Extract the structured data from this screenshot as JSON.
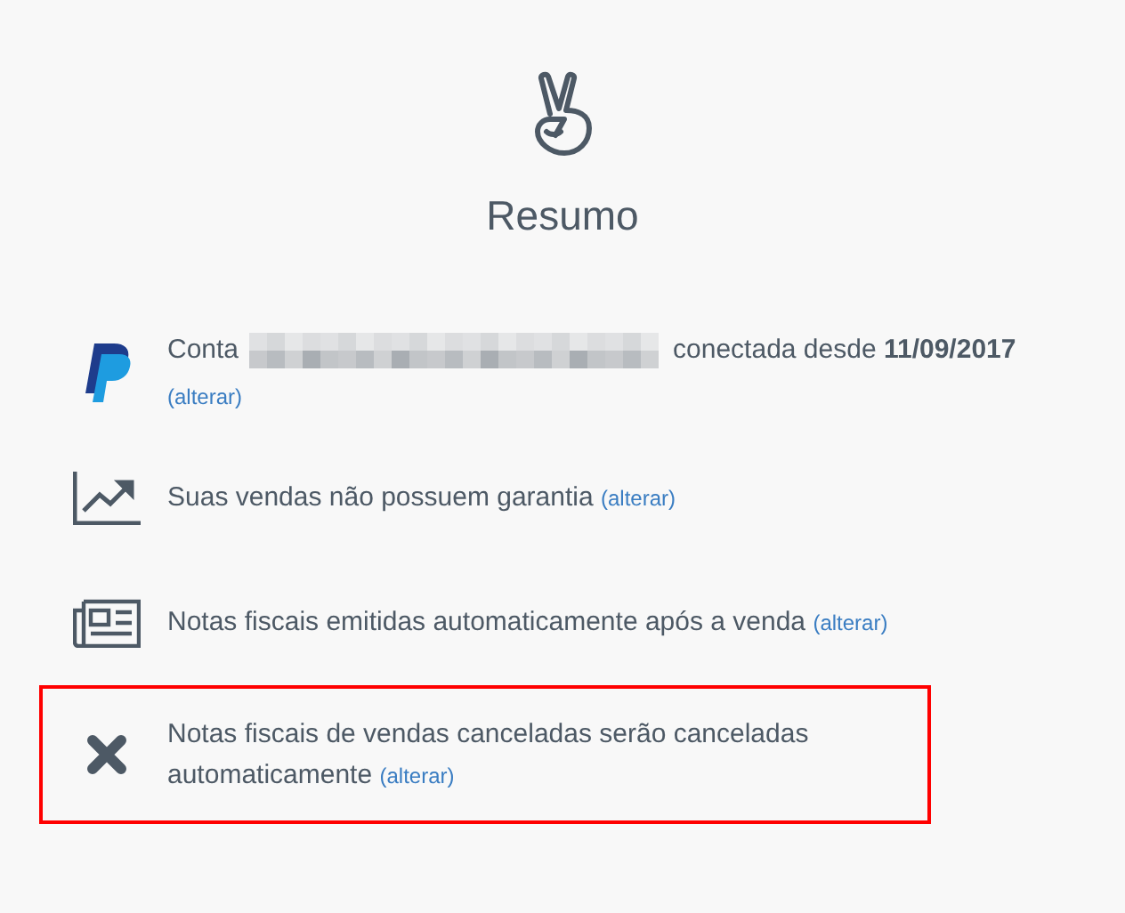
{
  "header": {
    "title": "Resumo"
  },
  "items": [
    {
      "kind": "paypal",
      "prefix": "Conta",
      "redacted": true,
      "text": "conectada desde **11/09/2017**",
      "link": "(alterar)",
      "link_below": true,
      "highlighted": false
    },
    {
      "kind": "chart",
      "text": "Suas vendas não possuem garantia",
      "link": "(alterar)",
      "link_below": false,
      "highlighted": false
    },
    {
      "kind": "newspaper",
      "text": "Notas fiscais emitidas automaticamente após a venda",
      "link": "(alterar)",
      "link_below": false,
      "highlighted": false
    },
    {
      "kind": "cross",
      "text": "Notas fiscais de vendas canceladas serão canceladas automaticamente",
      "link": "(alterar)",
      "link_below": false,
      "highlighted": true
    }
  ]
}
